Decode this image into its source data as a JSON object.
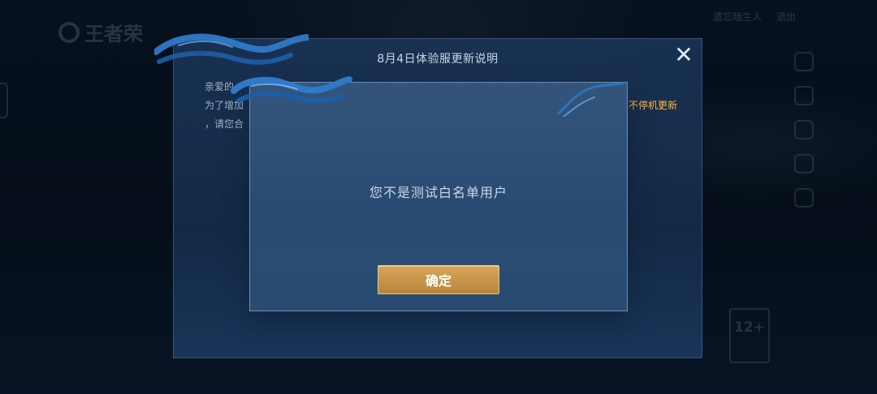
{
  "background": {
    "logo_text": "王者荣",
    "top_actions": [
      "遗忘暗生人",
      "退出"
    ],
    "age_rating": "12+"
  },
  "announcement": {
    "title": "8月4日体验服更新说明",
    "close_symbol": "✕",
    "line_1": "亲爱的",
    "line_2": "为了增加",
    "line_3": "，请您合",
    "highlight": "不停机更新"
  },
  "dialog": {
    "message": "您不是测试白名单用户",
    "confirm_label": "确定"
  },
  "colors": {
    "modal_background": "#2f5277",
    "button_gold": "#c89649",
    "highlight_orange": "#ffb43a"
  }
}
